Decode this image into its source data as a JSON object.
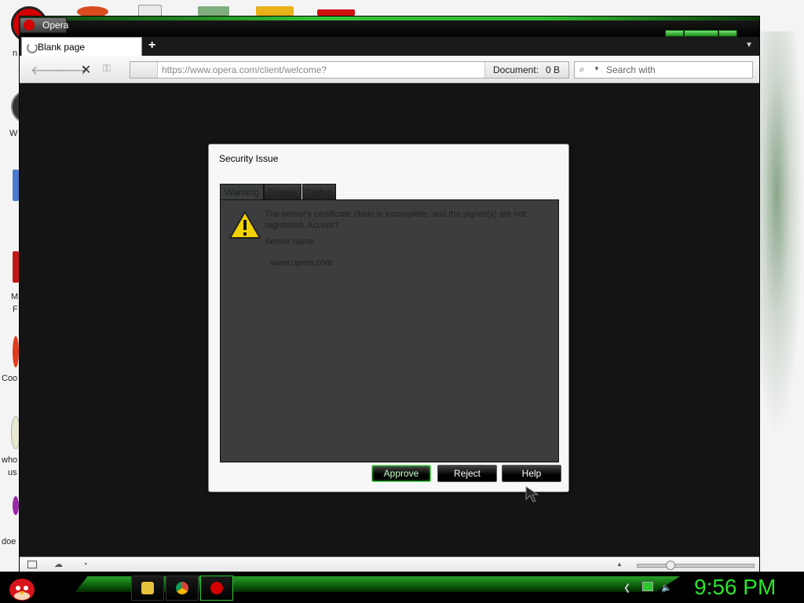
{
  "desktop": {
    "icon_labels": [
      "n",
      "W",
      "M",
      "F",
      "Coo",
      "who",
      "us",
      "doe"
    ]
  },
  "window": {
    "opera_button_label": "Opera",
    "tab_title": "Blank page",
    "new_tab_symbol": "+",
    "address_url": "https://www.opera.com/client/welcome?",
    "document_label": "Document:",
    "document_size": "0 B",
    "search_placeholder": "Search with"
  },
  "dialog": {
    "title": "Security Issue",
    "tabs": [
      "Warning",
      "Details",
      "Cipher"
    ],
    "message": "The server's certificate chain is incomplete, and the signer(s) are not registered. Accept?",
    "server_label": "Server name:",
    "server_name": "www.opera.com",
    "buttons": {
      "approve": "Approve",
      "reject": "Reject",
      "help": "Help"
    }
  },
  "taskbar": {
    "clock": "9:56 PM"
  },
  "colors": {
    "accent_green": "#29e629",
    "dialog_panel": "#3b3d3f"
  }
}
